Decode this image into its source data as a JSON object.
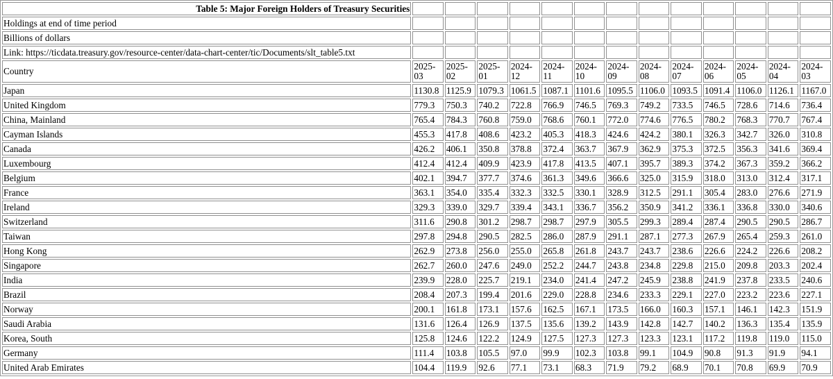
{
  "table": {
    "title": "Table 5: Major Foreign Holders of Treasury Securities",
    "notes": [
      "Holdings at end of time period",
      "Billions of dollars",
      "Link: https://ticdata.treasury.gov/resource-center/data-chart-center/tic/Documents/slt_table5.txt"
    ],
    "country_header": "Country",
    "periods": [
      [
        "2025-",
        "03"
      ],
      [
        "2025-",
        "02"
      ],
      [
        "2025-",
        "01"
      ],
      [
        "2024-",
        "12"
      ],
      [
        "2024-",
        "11"
      ],
      [
        "2024-",
        "10"
      ],
      [
        "2024-",
        "09"
      ],
      [
        "2024-",
        "08"
      ],
      [
        "2024-",
        "07"
      ],
      [
        "2024-",
        "06"
      ],
      [
        "2024-",
        "05"
      ],
      [
        "2024-",
        "04"
      ],
      [
        "2024-",
        "03"
      ]
    ],
    "rows": [
      {
        "country": "Japan",
        "values": [
          "1130.8",
          "1125.9",
          "1079.3",
          "1061.5",
          "1087.1",
          "1101.6",
          "1095.5",
          "1106.0",
          "1093.5",
          "1091.4",
          "1106.0",
          "1126.1",
          "1167.0"
        ]
      },
      {
        "country": "United Kingdom",
        "values": [
          "779.3",
          "750.3",
          "740.2",
          "722.8",
          "766.9",
          "746.5",
          "769.3",
          "749.2",
          "733.5",
          "746.5",
          "728.6",
          "714.6",
          "736.4"
        ]
      },
      {
        "country": "China, Mainland",
        "values": [
          "765.4",
          "784.3",
          "760.8",
          "759.0",
          "768.6",
          "760.1",
          "772.0",
          "774.6",
          "776.5",
          "780.2",
          "768.3",
          "770.7",
          "767.4"
        ]
      },
      {
        "country": "Cayman Islands",
        "values": [
          "455.3",
          "417.8",
          "408.6",
          "423.2",
          "405.3",
          "418.3",
          "424.6",
          "424.2",
          "380.1",
          "326.3",
          "342.7",
          "326.0",
          "310.8"
        ]
      },
      {
        "country": "Canada",
        "values": [
          "426.2",
          "406.1",
          "350.8",
          "378.8",
          "372.4",
          "363.7",
          "367.9",
          "362.9",
          "375.3",
          "372.5",
          "356.3",
          "341.6",
          "369.4"
        ]
      },
      {
        "country": "Luxembourg",
        "values": [
          "412.4",
          "412.4",
          "409.9",
          "423.9",
          "417.8",
          "413.5",
          "407.1",
          "395.7",
          "389.3",
          "374.2",
          "367.3",
          "359.2",
          "366.2"
        ]
      },
      {
        "country": "Belgium",
        "values": [
          "402.1",
          "394.7",
          "377.7",
          "374.6",
          "361.3",
          "349.6",
          "366.6",
          "325.0",
          "315.9",
          "318.0",
          "313.0",
          "312.4",
          "317.1"
        ]
      },
      {
        "country": "France",
        "values": [
          "363.1",
          "354.0",
          "335.4",
          "332.3",
          "332.5",
          "330.1",
          "328.9",
          "312.5",
          "291.1",
          "305.4",
          "283.0",
          "276.6",
          "271.9"
        ]
      },
      {
        "country": "Ireland",
        "values": [
          "329.3",
          "339.0",
          "329.7",
          "339.4",
          "343.1",
          "336.7",
          "356.2",
          "350.9",
          "341.2",
          "336.1",
          "336.8",
          "330.0",
          "340.6"
        ]
      },
      {
        "country": "Switzerland",
        "values": [
          "311.6",
          "290.8",
          "301.2",
          "298.7",
          "298.7",
          "297.9",
          "305.5",
          "299.3",
          "289.4",
          "287.4",
          "290.5",
          "290.5",
          "286.7"
        ]
      },
      {
        "country": "Taiwan",
        "values": [
          "297.8",
          "294.8",
          "290.5",
          "282.5",
          "286.0",
          "287.9",
          "291.1",
          "287.1",
          "277.3",
          "267.9",
          "265.4",
          "259.3",
          "261.0"
        ]
      },
      {
        "country": "Hong Kong",
        "values": [
          "262.9",
          "273.8",
          "256.0",
          "255.0",
          "265.8",
          "261.8",
          "243.7",
          "243.7",
          "238.6",
          "226.6",
          "224.2",
          "226.6",
          "208.2"
        ]
      },
      {
        "country": "Singapore",
        "values": [
          "262.7",
          "260.0",
          "247.6",
          "249.0",
          "252.2",
          "244.7",
          "243.8",
          "234.8",
          "229.8",
          "215.0",
          "209.8",
          "203.3",
          "202.4"
        ]
      },
      {
        "country": "India",
        "values": [
          "239.9",
          "228.0",
          "225.7",
          "219.1",
          "234.0",
          "241.4",
          "247.2",
          "245.9",
          "238.8",
          "241.9",
          "237.8",
          "233.5",
          "240.6"
        ]
      },
      {
        "country": "Brazil",
        "values": [
          "208.4",
          "207.3",
          "199.4",
          "201.6",
          "229.0",
          "228.8",
          "234.6",
          "233.3",
          "229.1",
          "227.0",
          "223.2",
          "223.6",
          "227.1"
        ]
      },
      {
        "country": "Norway",
        "values": [
          "200.1",
          "161.8",
          "173.1",
          "157.6",
          "162.5",
          "167.1",
          "173.5",
          "166.0",
          "160.3",
          "157.1",
          "146.1",
          "142.3",
          "151.9"
        ]
      },
      {
        "country": "Saudi Arabia",
        "values": [
          "131.6",
          "126.4",
          "126.9",
          "137.5",
          "135.6",
          "139.2",
          "143.9",
          "142.8",
          "142.7",
          "140.2",
          "136.3",
          "135.4",
          "135.9"
        ]
      },
      {
        "country": "Korea, South",
        "values": [
          "125.8",
          "124.6",
          "122.2",
          "124.9",
          "127.5",
          "127.3",
          "127.3",
          "123.3",
          "123.1",
          "117.2",
          "119.8",
          "119.0",
          "115.0"
        ]
      },
      {
        "country": "Germany",
        "values": [
          "111.4",
          "103.8",
          "105.5",
          "97.0",
          "99.9",
          "102.3",
          "103.8",
          "99.1",
          "104.9",
          "90.8",
          "91.3",
          "91.9",
          "94.1"
        ]
      },
      {
        "country": "United Arab Emirates",
        "values": [
          "104.4",
          "119.9",
          "92.6",
          "77.1",
          "73.1",
          "68.3",
          "71.9",
          "79.2",
          "68.9",
          "70.1",
          "70.8",
          "69.9",
          "70.9"
        ]
      }
    ]
  }
}
